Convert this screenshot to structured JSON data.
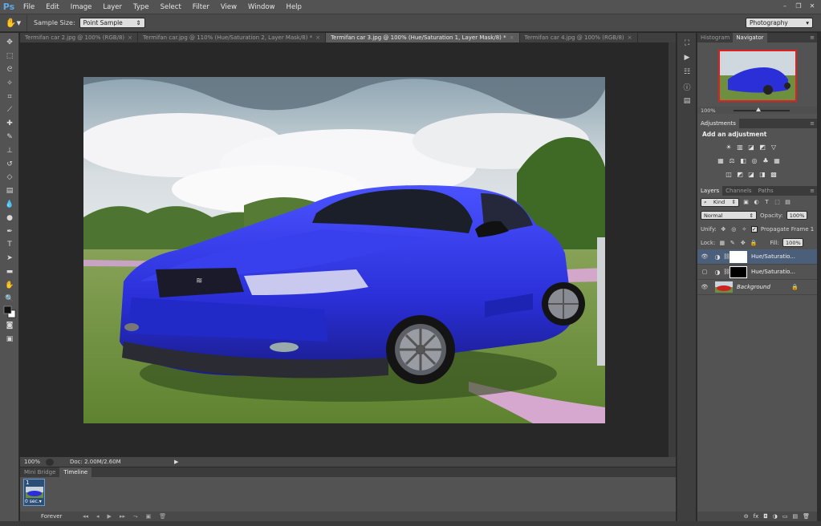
{
  "app": {
    "logo": "Ps",
    "menus": [
      "File",
      "Edit",
      "Image",
      "Layer",
      "Type",
      "Select",
      "Filter",
      "View",
      "Window",
      "Help"
    ],
    "window_controls": [
      "–",
      "❐",
      "✕"
    ]
  },
  "options_bar": {
    "sample_size_label": "Sample Size:",
    "sample_size_value": "Point Sample",
    "workspace": "Photography"
  },
  "tabs": [
    {
      "label": "Termifan car 2.jpg @ 100% (RGB/8)",
      "close": "×"
    },
    {
      "label": "Termifan car.jpg @ 110% (Hue/Saturation 2, Layer Mask/8) *",
      "close": "×"
    },
    {
      "label": "Termifan car 3.jpg @ 100% (Hue/Saturation 1, Layer Mask/8) *",
      "close": "×"
    },
    {
      "label": "Termifan car 4.jpg @ 100% (RGB/8)",
      "close": "×"
    }
  ],
  "status": {
    "zoom": "100%",
    "doc": "Doc: 2.00M/2.60M",
    "arrow": "▶"
  },
  "timeline": {
    "tabs": [
      "Mini Bridge",
      "Timeline"
    ],
    "frame_number": "1",
    "frame_delay": "0 sec.▾",
    "loop": "Forever",
    "controls": [
      "◂◂",
      "◂",
      "▶",
      "▸▸",
      "⤳",
      "▣",
      "🗑"
    ]
  },
  "panels": {
    "navigator": {
      "tabs": [
        "Histogram",
        "Navigator"
      ],
      "zoom": "100%"
    },
    "adjustments": {
      "tab": "Adjustments",
      "title": "Add an adjustment",
      "row1": [
        "☀",
        "▥",
        "◪",
        "◩",
        "▽"
      ],
      "row2": [
        "▦",
        "⚖",
        "◧",
        "◎",
        "♣",
        "▦"
      ],
      "row3": [
        "◫",
        "◩",
        "◪",
        "◨",
        "▩"
      ]
    },
    "layers": {
      "tabs": [
        "Layers",
        "Channels",
        "Paths"
      ],
      "filter_kind": "Kind",
      "blend_mode": "Normal",
      "opacity_label": "Opacity:",
      "opacity": "100%",
      "unify_label": "Unify:",
      "propagate_label": "Propagate Frame 1",
      "lock_label": "Lock:",
      "fill_label": "Fill:",
      "fill": "100%",
      "items": [
        {
          "name": "Hue/Saturatio...",
          "visible": true,
          "mask": "white",
          "selected": true
        },
        {
          "name": "Hue/Saturatio...",
          "visible": false,
          "mask": "black",
          "selected": false
        },
        {
          "name": "Background",
          "visible": true,
          "mask": "image",
          "selected": false
        }
      ],
      "bottom_icons": [
        "⊖",
        "fx",
        "◘",
        "◑",
        "▭",
        "▤",
        "🗑"
      ]
    }
  },
  "colors": {
    "accent": "#5ea9e9",
    "car": "#2a2fd8",
    "selection": "#4b5f7a"
  }
}
